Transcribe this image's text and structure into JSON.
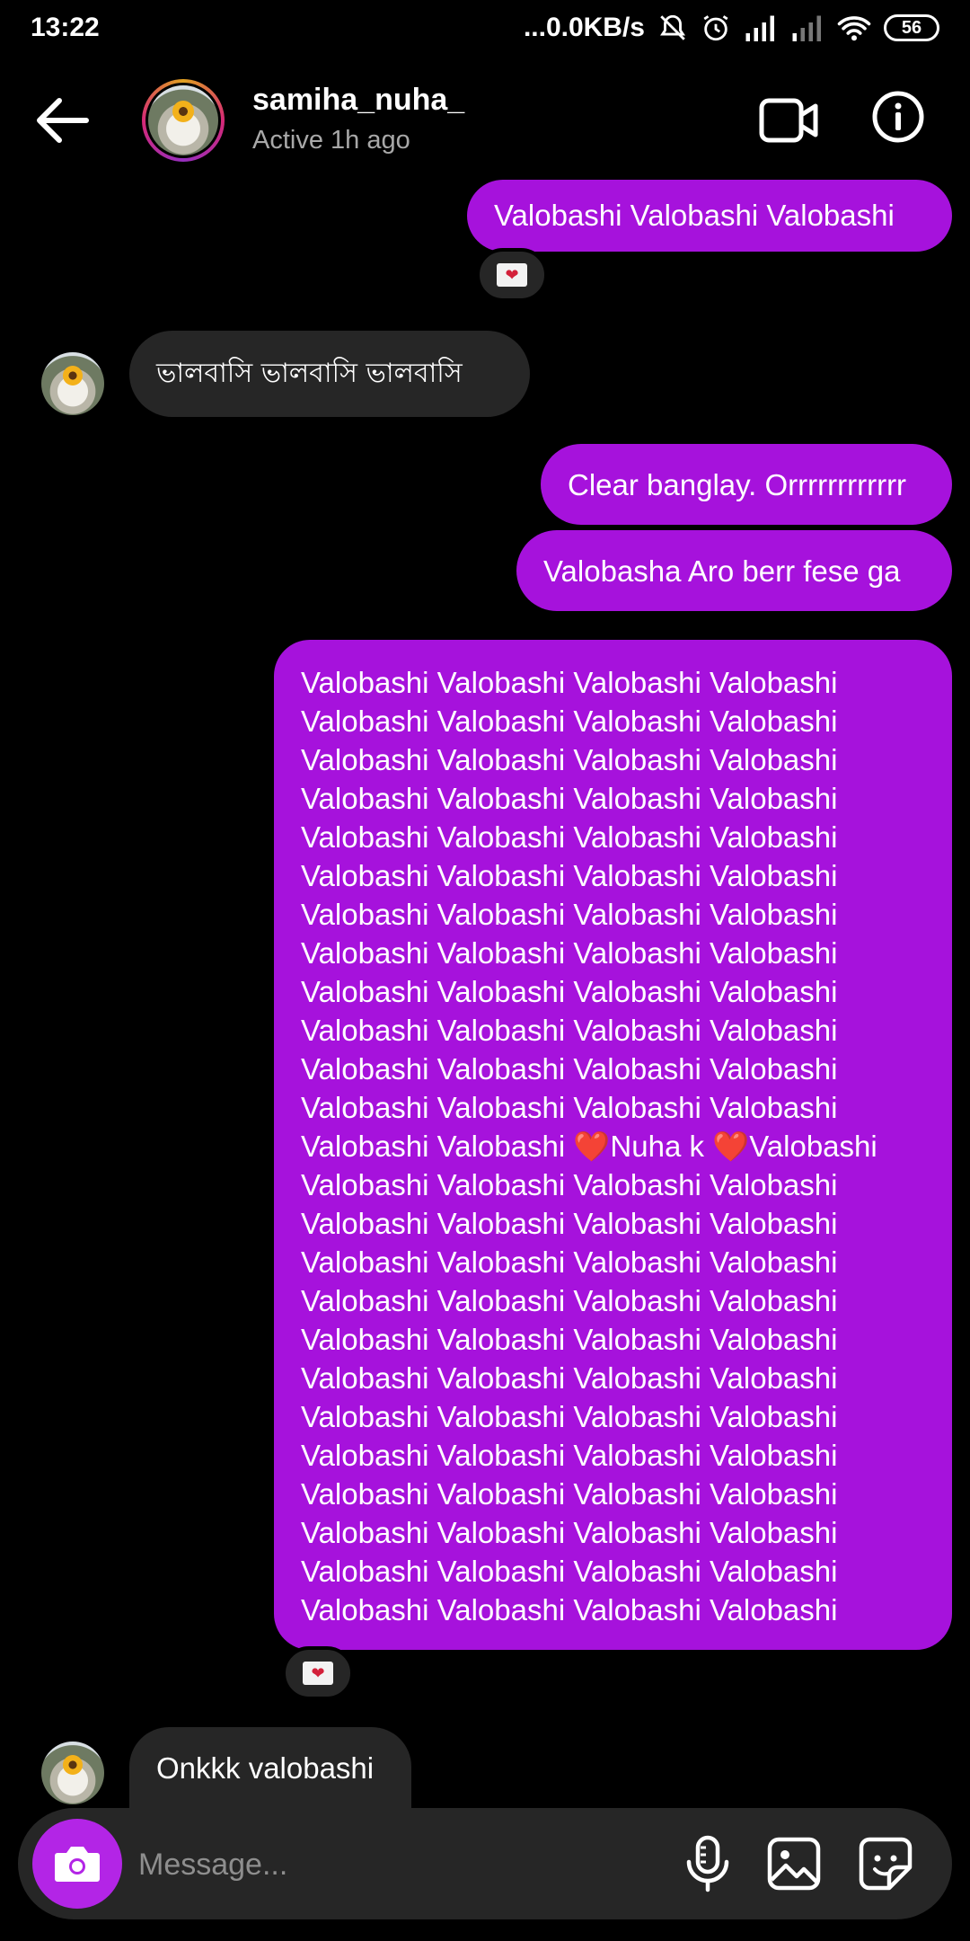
{
  "status_bar": {
    "time": "13:22",
    "network_speed": "...0.0KB/s",
    "battery": "56",
    "icons": [
      "mute-icon",
      "alarm-icon",
      "signal-icon",
      "signal-weak-icon",
      "wifi-icon",
      "battery-icon"
    ]
  },
  "header": {
    "username": "samiha_nuha_",
    "status": "Active 1h ago",
    "icons": [
      "back-arrow-icon",
      "video-call-icon",
      "info-icon"
    ]
  },
  "messages": [
    {
      "from": "me",
      "text": "Valobashi Valobashi Valobashi"
    },
    {
      "from": "them",
      "text": "ভালবাসি ভালবাসি ভালবাসি"
    },
    {
      "from": "me",
      "text": "Clear banglay. Orrrrrrrrrrrr"
    },
    {
      "from": "me",
      "text": "Valobasha Aro berr fese ga"
    },
    {
      "from": "me",
      "lines": [
        "Valobashi Valobashi Valobashi Valobashi",
        "Valobashi Valobashi Valobashi Valobashi",
        "Valobashi Valobashi Valobashi Valobashi",
        "Valobashi Valobashi Valobashi Valobashi",
        "Valobashi Valobashi Valobashi Valobashi",
        "Valobashi Valobashi Valobashi Valobashi",
        "Valobashi Valobashi Valobashi Valobashi",
        "Valobashi Valobashi Valobashi Valobashi",
        "Valobashi Valobashi Valobashi Valobashi",
        "Valobashi Valobashi Valobashi Valobashi",
        "Valobashi Valobashi Valobashi Valobashi",
        "Valobashi Valobashi Valobashi Valobashi",
        "Valobashi Valobashi ❤️Nuha k ❤️Valobashi",
        "Valobashi Valobashi Valobashi Valobashi",
        "Valobashi Valobashi Valobashi Valobashi",
        "Valobashi Valobashi Valobashi Valobashi",
        "Valobashi Valobashi Valobashi Valobashi",
        "Valobashi Valobashi Valobashi Valobashi",
        "Valobashi Valobashi Valobashi Valobashi",
        "Valobashi Valobashi Valobashi Valobashi",
        "Valobashi Valobashi Valobashi Valobashi",
        "Valobashi Valobashi Valobashi Valobashi",
        "Valobashi Valobashi Valobashi Valobashi",
        "Valobashi Valobashi Valobashi Valobashi",
        "Valobashi Valobashi Valobashi Valobashi"
      ]
    },
    {
      "from": "them",
      "text": "Onkkk valobashi"
    }
  ],
  "reactions": {
    "icon": "love-letter-icon",
    "glyph": "❤"
  },
  "composer": {
    "placeholder": "Message...",
    "icons": [
      "camera-icon",
      "microphone-icon",
      "gallery-icon",
      "sticker-icon"
    ]
  },
  "colors": {
    "sent_bubble": "#a612dc",
    "received_bubble": "#262626",
    "camera_button": "#b325e6",
    "background": "#000000"
  }
}
